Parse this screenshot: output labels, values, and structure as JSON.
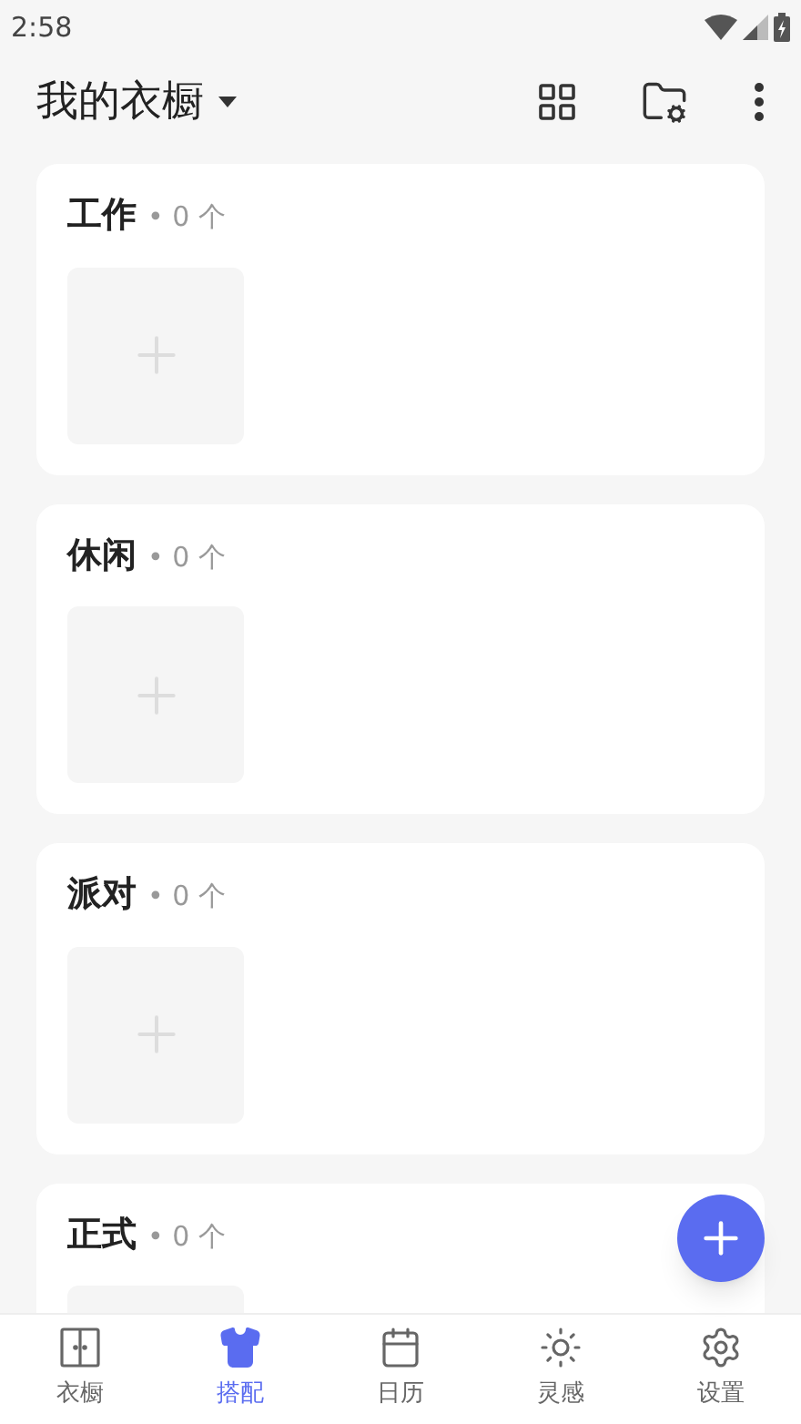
{
  "status_bar": {
    "time": "2:58"
  },
  "header": {
    "title": "我的衣橱"
  },
  "categories": [
    {
      "name": "工作",
      "count": "• 0 个"
    },
    {
      "name": "休闲",
      "count": "• 0 个"
    },
    {
      "name": "派对",
      "count": "• 0 个"
    },
    {
      "name": "正式",
      "count": "• 0 个"
    }
  ],
  "bottom_nav": [
    {
      "kind": "wardrobe",
      "label": "衣橱",
      "selected": false
    },
    {
      "kind": "outfit",
      "label": "搭配",
      "selected": true
    },
    {
      "kind": "calendar",
      "label": "日历",
      "selected": false
    },
    {
      "kind": "inspiration",
      "label": "灵感",
      "selected": false
    },
    {
      "kind": "settings",
      "label": "设置",
      "selected": false
    }
  ]
}
